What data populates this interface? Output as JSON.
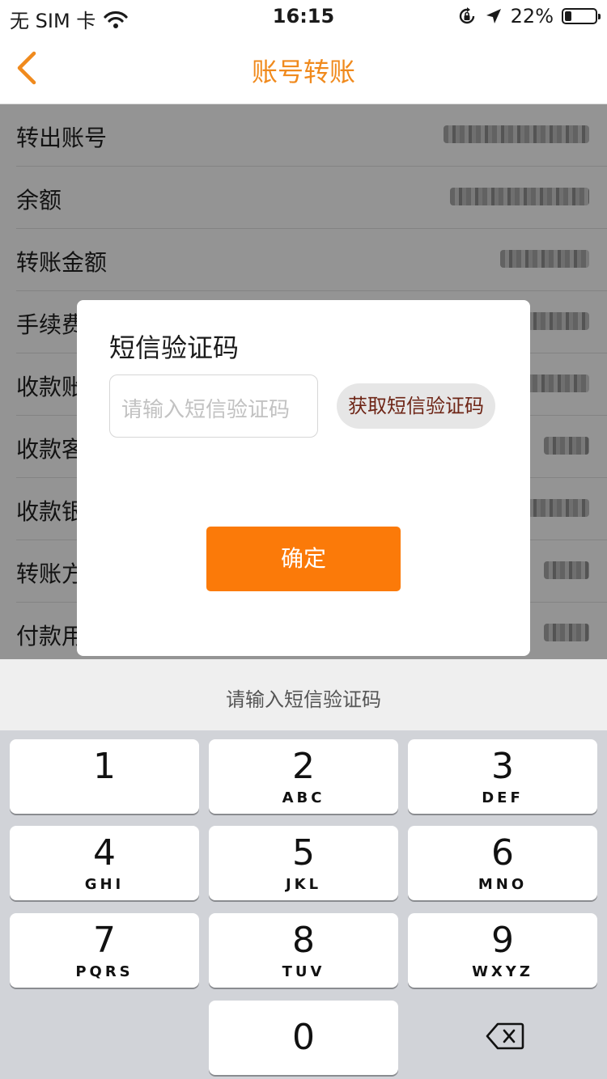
{
  "status_bar": {
    "carrier": "无 SIM 卡",
    "time": "16:15",
    "battery_percent": "22%",
    "battery_level": 0.22,
    "icons": [
      "wifi-icon",
      "orientation-lock-icon",
      "location-arrow-icon",
      "battery-icon"
    ]
  },
  "nav": {
    "title": "账号转账",
    "back_icon": "chevron-left-icon"
  },
  "form_rows": [
    {
      "label": "转出账号"
    },
    {
      "label": "余额"
    },
    {
      "label": "转账金额"
    },
    {
      "label": "手续费"
    },
    {
      "label": "收款账号"
    },
    {
      "label": "收款客户名"
    },
    {
      "label": "收款银行"
    },
    {
      "label": "转账方式"
    },
    {
      "label": "付款用途"
    }
  ],
  "dialog": {
    "title": "短信验证码",
    "code_placeholder": "请输入短信验证码",
    "get_code_label": "获取短信验证码",
    "confirm_label": "确定"
  },
  "keyboard": {
    "hint": "请输入短信验证码",
    "keys": [
      {
        "num": "1",
        "letters": ""
      },
      {
        "num": "2",
        "letters": "ABC"
      },
      {
        "num": "3",
        "letters": "DEF"
      },
      {
        "num": "4",
        "letters": "GHI"
      },
      {
        "num": "5",
        "letters": "JKL"
      },
      {
        "num": "6",
        "letters": "MNO"
      },
      {
        "num": "7",
        "letters": "PQRS"
      },
      {
        "num": "8",
        "letters": "TUV"
      },
      {
        "num": "9",
        "letters": "WXYZ"
      },
      {
        "num": "0",
        "letters": ""
      }
    ],
    "delete_icon": "backspace-icon"
  },
  "colors": {
    "accent": "#f08a1d",
    "confirm_button": "#fb7a09",
    "get_code_text": "#6e2516"
  }
}
